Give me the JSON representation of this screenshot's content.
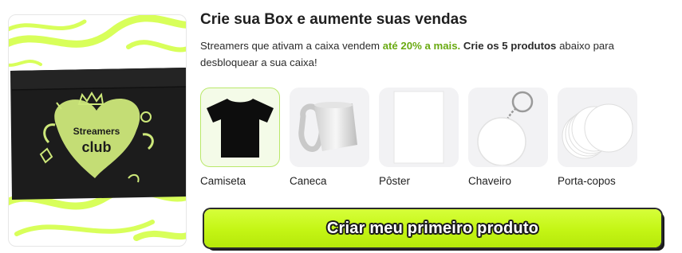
{
  "hero": {
    "box_brand_line1": "Streamers",
    "box_brand_line2": "club",
    "colors": {
      "accent": "#d8ff5a",
      "box": "#1c1c1c"
    }
  },
  "header": {
    "title": "Crie sua Box e aumente suas vendas"
  },
  "description": {
    "part1": "Streamers que ativam a caixa vendem ",
    "highlight": "até 20% a mais.",
    "part2": " ",
    "strong": "Crie os 5 produtos",
    "part3": " abaixo para desbloquear a sua caixa!"
  },
  "products": [
    {
      "label": "Camiseta",
      "icon": "tshirt-icon",
      "selected": true
    },
    {
      "label": "Caneca",
      "icon": "mug-icon",
      "selected": false
    },
    {
      "label": "Pôster",
      "icon": "poster-icon",
      "selected": false
    },
    {
      "label": "Chaveiro",
      "icon": "keychain-icon",
      "selected": false
    },
    {
      "label": "Porta-copos",
      "icon": "coasters-icon",
      "selected": false
    }
  ],
  "cta": {
    "label": "Criar meu primeiro produto",
    "color": "#c4f514"
  }
}
